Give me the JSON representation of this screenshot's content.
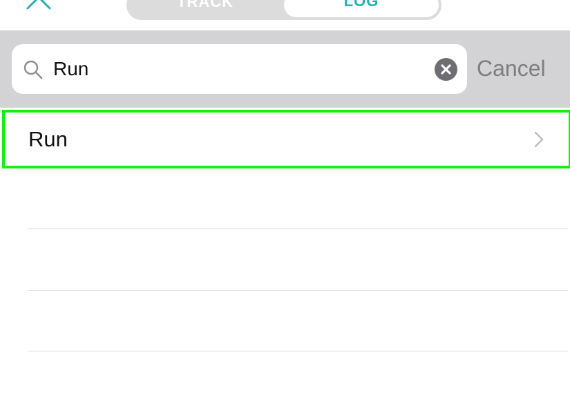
{
  "header": {
    "close_icon": "close-icon",
    "tabs": [
      {
        "label": "TRACK",
        "selected": false
      },
      {
        "label": "LOG",
        "selected": true
      }
    ]
  },
  "search": {
    "value": "Run",
    "icon": "search-icon",
    "clear_icon": "clear-icon",
    "cancel_label": "Cancel"
  },
  "results": [
    {
      "label": "Run",
      "highlighted": true,
      "icon": "chevron-right-icon"
    }
  ],
  "colors": {
    "accent": "#25b0b6",
    "highlight": "#14f014",
    "search_bar_bg": "#d3d3d6"
  }
}
